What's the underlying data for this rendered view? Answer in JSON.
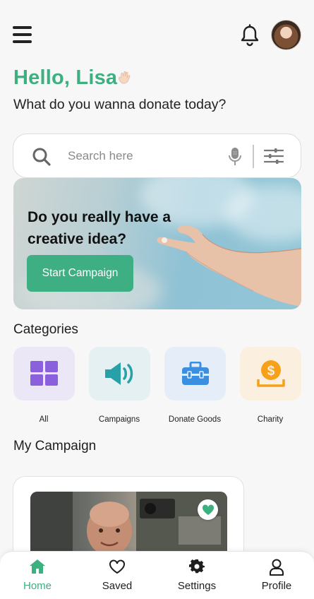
{
  "header": {
    "greeting": "Hello, Lisa",
    "subtitle": "What do you wanna donate today?",
    "icons": [
      "menu-icon",
      "bell-icon",
      "avatar"
    ]
  },
  "search": {
    "placeholder": "Search here",
    "icons": [
      "search-icon",
      "microphone-icon",
      "filter-sliders-icon"
    ]
  },
  "banner": {
    "title": "Do you really have a creative idea?",
    "cta_label": "Start Campaign"
  },
  "categories": {
    "title": "Categories",
    "items": [
      {
        "label": "All",
        "icon": "grid-icon",
        "bg": "#ebe7f7",
        "color": "#8a60dc"
      },
      {
        "label": "Campaigns",
        "icon": "megaphone-icon",
        "bg": "#e4f0f1",
        "color": "#27a0a7"
      },
      {
        "label": "Donate Goods",
        "icon": "toolbox-icon",
        "bg": "#e5eef8",
        "color": "#3b8fe0"
      },
      {
        "label": "Charity",
        "icon": "coin-hand-icon",
        "bg": "#fbefe0",
        "color": "#f7a01a"
      }
    ]
  },
  "my_campaign": {
    "title": "My Campaign"
  },
  "tabbar": {
    "items": [
      {
        "label": "Home",
        "icon": "home-icon",
        "active": true
      },
      {
        "label": "Saved",
        "icon": "heart-icon",
        "active": false
      },
      {
        "label": "Settings",
        "icon": "gear-icon",
        "active": false
      },
      {
        "label": "Profile",
        "icon": "person-icon",
        "active": false
      }
    ]
  },
  "colors": {
    "accent": "#3db080",
    "text": "#1e1e1e",
    "background": "#f7f7f8"
  }
}
